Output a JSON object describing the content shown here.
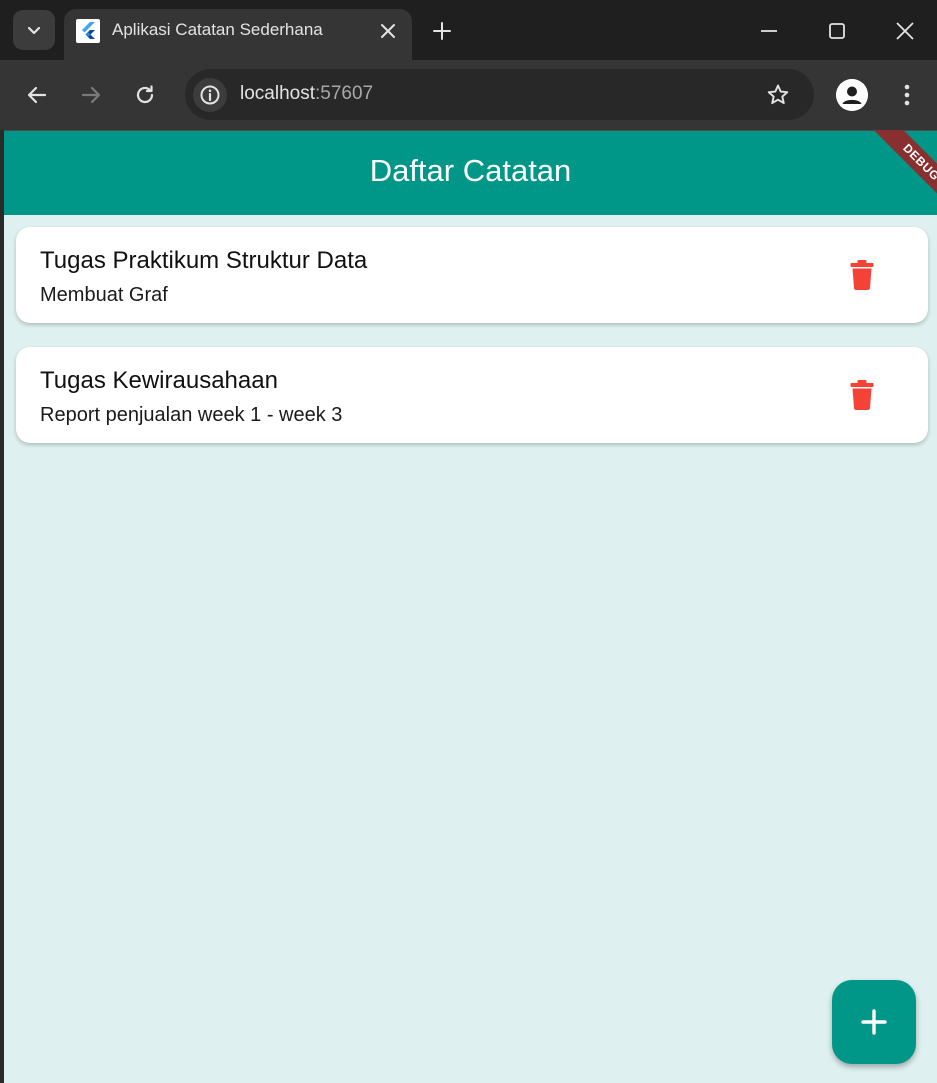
{
  "browser": {
    "tab": {
      "title": "Aplikasi Catatan Sederhana",
      "favicon": "flutter-icon"
    },
    "toolbar": {
      "url_host": "localhost",
      "url_port": ":57607"
    }
  },
  "app": {
    "appbar_title": "Daftar Catatan",
    "debug_banner": "DEBUG",
    "colors": {
      "primary": "#009688",
      "background": "#dff0f0",
      "delete": "#f44336"
    },
    "notes": [
      {
        "title": "Tugas Praktikum Struktur Data",
        "subtitle": "Membuat Graf"
      },
      {
        "title": "Tugas Kewirausahaan",
        "subtitle": "Report penjualan week 1 - week 3"
      }
    ],
    "fab_icon": "add-icon"
  }
}
